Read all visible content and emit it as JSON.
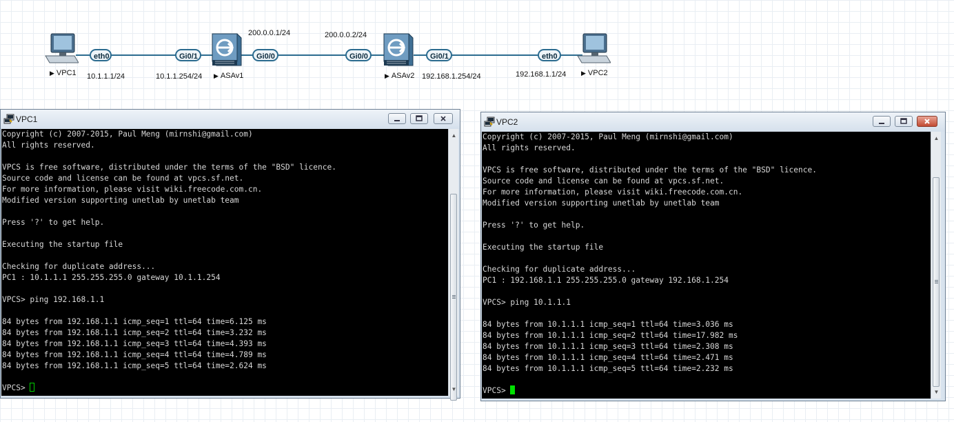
{
  "topology": {
    "nodes": [
      {
        "name": "VPC1",
        "type": "pc"
      },
      {
        "name": "ASAv1",
        "type": "firewall"
      },
      {
        "name": "ASAv2",
        "type": "firewall"
      },
      {
        "name": "VPC2",
        "type": "pc"
      }
    ],
    "interfaces": {
      "vpc1_eth0": "eth0",
      "asav1_gi01": "Gi0/1",
      "asav1_gi00": "Gi0/0",
      "asav2_gi00": "Gi0/0",
      "asav2_gi01": "Gi0/1",
      "vpc2_eth0": "eth0"
    },
    "addresses": {
      "vpc1": "10.1.1.1/24",
      "asav1_inside": "10.1.1.254/24",
      "asav1_outside": "200.0.0.1/24",
      "asav2_outside": "200.0.0.2/24",
      "asav2_inside": "192.168.1.254/24",
      "vpc2": "192.168.1.1/24"
    }
  },
  "windows": {
    "vpc1": {
      "title": "VPC1",
      "lines": [
        "Copyright (c) 2007-2015, Paul Meng (mirnshi@gmail.com)",
        "All rights reserved.",
        "",
        "VPCS is free software, distributed under the terms of the \"BSD\" licence.",
        "Source code and license can be found at vpcs.sf.net.",
        "For more information, please visit wiki.freecode.com.cn.",
        "Modified version supporting unetlab by unetlab team",
        "",
        "Press '?' to get help.",
        "",
        "Executing the startup file",
        "",
        "Checking for duplicate address...",
        "PC1 : 10.1.1.1 255.255.255.0 gateway 10.1.1.254",
        "",
        "VPCS> ping 192.168.1.1",
        "",
        "84 bytes from 192.168.1.1 icmp_seq=1 ttl=64 time=6.125 ms",
        "84 bytes from 192.168.1.1 icmp_seq=2 ttl=64 time=3.232 ms",
        "84 bytes from 192.168.1.1 icmp_seq=3 ttl=64 time=4.393 ms",
        "84 bytes from 192.168.1.1 icmp_seq=4 ttl=64 time=4.789 ms",
        "84 bytes from 192.168.1.1 icmp_seq=5 ttl=64 time=2.624 ms",
        ""
      ],
      "prompt": "VPCS> "
    },
    "vpc2": {
      "title": "VPC2",
      "lines": [
        "Copyright (c) 2007-2015, Paul Meng (mirnshi@gmail.com)",
        "All rights reserved.",
        "",
        "VPCS is free software, distributed under the terms of the \"BSD\" licence.",
        "Source code and license can be found at vpcs.sf.net.",
        "For more information, please visit wiki.freecode.com.cn.",
        "Modified version supporting unetlab by unetlab team",
        "",
        "Press '?' to get help.",
        "",
        "Executing the startup file",
        "",
        "Checking for duplicate address...",
        "PC1 : 192.168.1.1 255.255.255.0 gateway 192.168.1.254",
        "",
        "VPCS> ping 10.1.1.1",
        "",
        "84 bytes from 10.1.1.1 icmp_seq=1 ttl=64 time=3.036 ms",
        "84 bytes from 10.1.1.1 icmp_seq=2 ttl=64 time=17.982 ms",
        "84 bytes from 10.1.1.1 icmp_seq=3 ttl=64 time=2.308 ms",
        "84 bytes from 10.1.1.1 icmp_seq=4 ttl=64 time=2.471 ms",
        "84 bytes from 10.1.1.1 icmp_seq=5 ttl=64 time=2.232 ms",
        ""
      ],
      "prompt": "VPCS> "
    }
  },
  "colors": {
    "link": "#2b6b8f",
    "terminal_bg": "#000000",
    "terminal_fg": "#d8d8d8",
    "cursor": "#00e000",
    "close_button": "#c24b33"
  },
  "icons": {
    "pc": "desktop-pc-icon",
    "firewall": "asa-firewall-icon",
    "window": "putty-terminal-icon"
  }
}
